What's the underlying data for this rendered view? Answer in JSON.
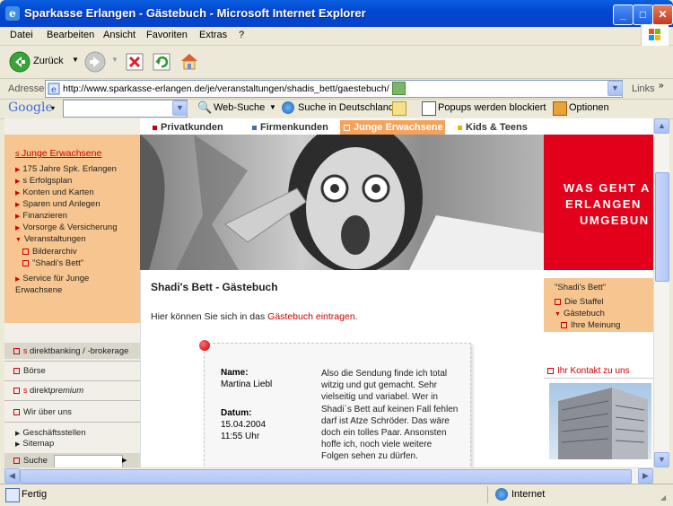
{
  "window": {
    "title": "Sparkasse Erlangen - Gästebuch - Microsoft Internet Explorer",
    "minimize": "_",
    "maximize": "□",
    "close": "✕"
  },
  "menu": [
    "Datei",
    "Bearbeiten",
    "Ansicht",
    "Favoriten",
    "Extras",
    "?"
  ],
  "toolbar": {
    "back_label": "Zurück",
    "back_icon": "back-arrow-icon",
    "forward_icon": "forward-arrow-icon",
    "stop_icon": "stop-icon",
    "refresh_icon": "refresh-icon",
    "home_icon": "home-icon"
  },
  "address": {
    "label": "Adresse",
    "url": "http://www.sparkasse-erlangen.de/je/veranstaltungen/shadis_bett/gaestebuch/",
    "links_label": "Links"
  },
  "googlebar": {
    "logo": "Google",
    "web_search": "Web-Suche",
    "search_germany": "Suche in Deutschland",
    "popups": "Popups werden blockiert",
    "options": "Optionen"
  },
  "page": {
    "nav_tabs": [
      {
        "label": "Privatkunden",
        "active": false
      },
      {
        "label": "Firmenkunden",
        "active": false
      },
      {
        "label": "Junge Erwachsene",
        "active": true
      },
      {
        "label": "Kids & Teens",
        "active": false
      }
    ],
    "left_nav": {
      "heading": "Junge Erwachsene",
      "items": [
        "175 Jahre Spk. Erlangen",
        "s Erfolgsplan",
        "Konten und Karten",
        "Sparen und Anlegen",
        "Finanzieren",
        "Vorsorge & Versicherung",
        "Veranstaltungen"
      ],
      "subitems": [
        "Bilderarchiv",
        "\"Shadi's Bett\""
      ],
      "service_line1": "Service für Junge",
      "service_line2": "Erwachsene",
      "direktbanking": "direktbanking / -brokerage",
      "boerse": "Börse",
      "direktpremium_a": "direkt",
      "direktpremium_b": "premium",
      "wir_ueber_uns": "Wir über uns",
      "geschaeftsstellen": "Geschäftsstellen",
      "sitemap": "Sitemap",
      "suche": "Suche"
    },
    "banner_right_lines": [
      "WAS GEHT A",
      "ERLANGEN",
      "UMGEBUN"
    ],
    "main": {
      "heading": "Shadi's Bett - Gästebuch",
      "intro_text": "Hier können Sie sich in das",
      "intro_link": "Gästebuch eintragen.",
      "entry": {
        "name_label": "Name:",
        "name_value": "Martina Liebl",
        "date_label": "Datum:",
        "date_value": "15.04.2004",
        "time_value": "11:55 Uhr",
        "message": "Also die Sendung finde ich total witzig und gut gemacht. Sehr vielseitig und variabel. Wer in Shadi´s Bett auf keinen Fall fehlen darf ist Atze Schröder. Das wäre doch ein tolles Paar. Ansonsten hoffe ich, noch viele weitere Folgen sehen zu dürfen."
      }
    },
    "right_nav": {
      "heading": "\"Shadi's Bett\"",
      "items": [
        "Die Staffel",
        "Gästebuch"
      ],
      "subitem": "Ihre Meinung",
      "contact": "Ihr Kontakt zu uns"
    }
  },
  "status": {
    "text": "Fertig",
    "zone": "Internet"
  },
  "colors": {
    "accent_red": "#cc0000",
    "nav_orange": "#f5a25a",
    "sidebar_peach": "#f7c690",
    "xp_blue": "#0347D0"
  }
}
